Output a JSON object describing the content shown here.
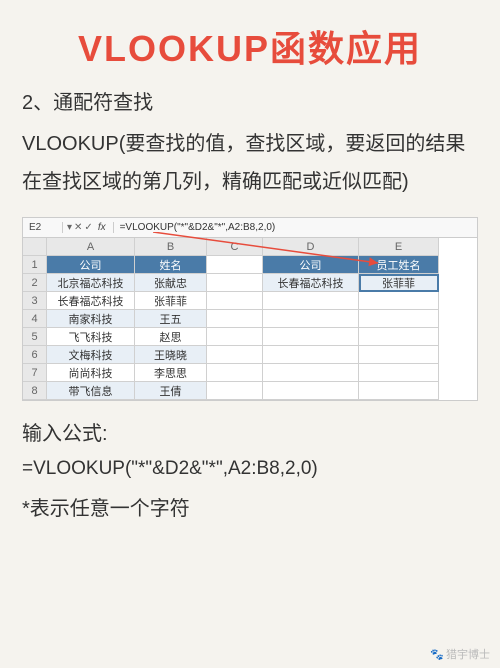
{
  "title": "VLOOKUP函数应用",
  "subtitle": "2、通配符查找",
  "description": "VLOOKUP(要查找的值，查找区域，要返回的结果在查找区域的第几列，精确匹配或近似匹配)",
  "formulaBar": {
    "cellRef": "E2",
    "fx": "fx",
    "formula": "=VLOOKUP(\"*\"&D2&\"*\",A2:B8,2,0)"
  },
  "sheet": {
    "columns": [
      "",
      "A",
      "B",
      "C",
      "D",
      "E"
    ],
    "rows": [
      {
        "n": "1",
        "cells": [
          "公司",
          "姓名",
          "",
          "公司",
          "员工姓名"
        ],
        "header": true
      },
      {
        "n": "2",
        "cells": [
          "北京福芯科技",
          "张献忠",
          "",
          "长春福芯科技",
          "张菲菲"
        ]
      },
      {
        "n": "3",
        "cells": [
          "长春福芯科技",
          "张菲菲",
          "",
          "",
          ""
        ]
      },
      {
        "n": "4",
        "cells": [
          "南家科技",
          "王五",
          "",
          "",
          ""
        ]
      },
      {
        "n": "5",
        "cells": [
          "飞飞科技",
          "赵思",
          "",
          "",
          ""
        ]
      },
      {
        "n": "6",
        "cells": [
          "文梅科技",
          "王晓晓",
          "",
          "",
          ""
        ]
      },
      {
        "n": "7",
        "cells": [
          "尚尚科技",
          "李思思",
          "",
          "",
          ""
        ]
      },
      {
        "n": "8",
        "cells": [
          "带飞信息",
          "王倩",
          "",
          "",
          ""
        ]
      }
    ]
  },
  "inputLabel": "输入公式:",
  "inputFormula": "=VLOOKUP(\"*\"&D2&\"*\",A2:B8,2,0)",
  "note": "*表示任意一个字符",
  "watermark": "猎宇博士"
}
